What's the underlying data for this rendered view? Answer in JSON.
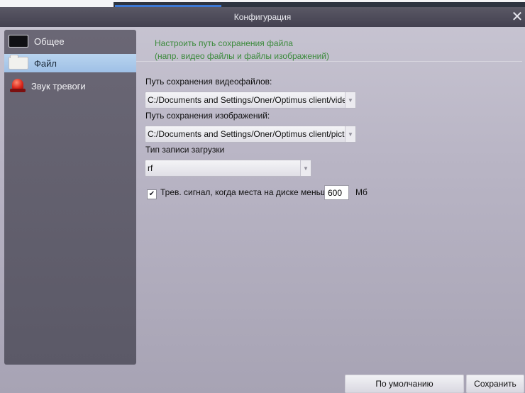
{
  "window": {
    "title": "Конфигурация"
  },
  "sidebar": {
    "items": [
      {
        "label": "Общее",
        "icon": "monitor-icon"
      },
      {
        "label": "Файл",
        "icon": "folder-icon",
        "selected": true
      },
      {
        "label": "Звук тревоги",
        "icon": "alarm-bell-icon"
      }
    ]
  },
  "main": {
    "hint_line1": "Настроить путь сохранения файла",
    "hint_line2": "(напр. видео файлы и файлы изображений)",
    "video_path_label": "Путь сохранения видеофайлов:",
    "video_path_value": "C:/Documents and Settings/Oner/Optimus client/video",
    "image_path_label": "Путь сохранения изображений:",
    "image_path_value": "C:/Documents and Settings/Oner/Optimus client/picture",
    "record_type_label": "Тип записи загрузки",
    "record_type_value": "rf",
    "alarm_checkbox_label": "Трев. сигнал, когда места на диске меньше",
    "alarm_checkbox_checked": true,
    "disk_threshold_value": "600",
    "disk_threshold_unit": "Мб"
  },
  "footer": {
    "default_button_label": "По умолчанию",
    "save_button_label": "Сохранить"
  },
  "colors": {
    "hint_text": "#3b8a3b",
    "selected_item": "#a9c8ea",
    "sidebar_bg": "#646170",
    "titlebar_bg": "#4b4958"
  }
}
